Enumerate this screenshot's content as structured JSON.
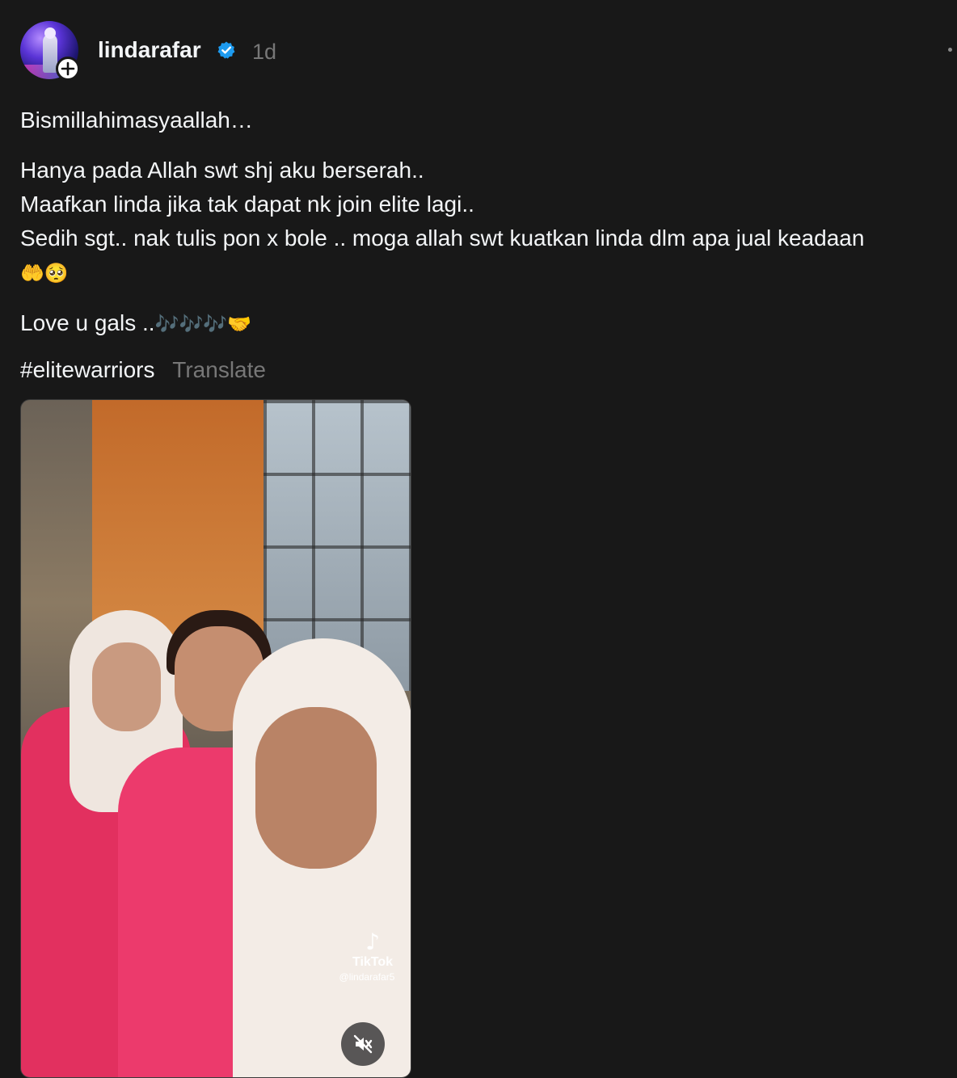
{
  "post": {
    "author": {
      "username": "lindarafar",
      "verified": true,
      "timestamp": "1d"
    },
    "caption": {
      "line1": "Bismillahimasyaallah…",
      "line2": "Hanya pada Allah swt shj aku berserah..",
      "line3": "Maafkan linda jika tak dapat nk join elite lagi..",
      "line4": "Sedih sgt.. nak tulis pon x bole .. moga allah swt kuatkan linda dlm apa jual keadaan",
      "line4_emoji": "🤲🥺",
      "line5": "Love u gals ..",
      "line5_emoji": "🎶🎶🎶🤝"
    },
    "hashtag": "#elitewarriors",
    "translate_label": "Translate",
    "media": {
      "watermark_brand": "TikTok",
      "watermark_handle": "@lindarafar5",
      "muted": true
    }
  },
  "icons": {
    "follow": "plus-icon",
    "verified": "verified-badge-icon",
    "more": "more-icon",
    "mute": "speaker-muted-icon"
  },
  "colors": {
    "background": "#181818",
    "text_primary": "#f3f5f7",
    "text_secondary": "#777777",
    "verified_blue": "#1d9bf0"
  }
}
